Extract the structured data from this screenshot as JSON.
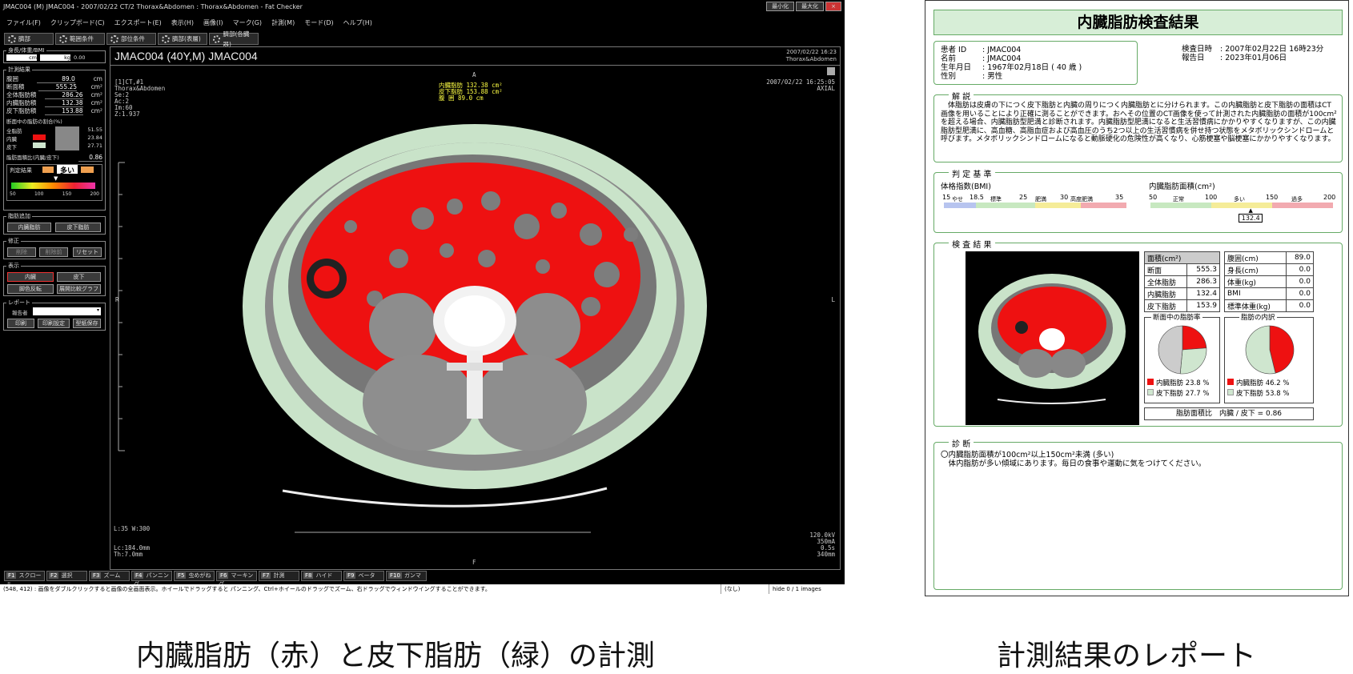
{
  "app": {
    "title": "JMAC004 (M) JMAC004 - 2007/02/22 CT/2 Thorax&Abdomen : Thorax&Abdomen - Fat Checker",
    "window_buttons": {
      "minimize": "最小化",
      "maximize": "最大化",
      "close": "×"
    },
    "menu": [
      "ファイル(F)",
      "クリップボード(C)",
      "エクスポート(E)",
      "表示(H)",
      "画像(I)",
      "マーク(G)",
      "計測(M)",
      "モード(D)",
      "ヘルプ(H)"
    ],
    "toolbar": [
      "臍部",
      "範囲条件",
      "部位条件",
      "臍部(表層)",
      "臍部(各臓器)"
    ],
    "panel": {
      "body_group": "身長/体重/BMI",
      "body_vals": [
        "cm",
        "kg",
        "0.00"
      ],
      "measure_group": "計測結果",
      "rows": [
        {
          "label": "腹囲",
          "value": "89.0",
          "unit": "cm"
        },
        {
          "label": "断面積",
          "value": "555.25",
          "unit": "cm²"
        },
        {
          "label": "全体脂肪積",
          "value": "286.26",
          "unit": "cm²"
        },
        {
          "label": "内臓脂肪積",
          "value": "132.38",
          "unit": "cm²"
        },
        {
          "label": "皮下脂肪積",
          "value": "153.88",
          "unit": "cm²"
        }
      ],
      "ratio_title": "断面中の脂肪の割合(%)",
      "ratio_rows": [
        {
          "label": "全脂肪",
          "value": "51.55"
        },
        {
          "label": "内臓",
          "value": "23.84"
        },
        {
          "label": "皮下",
          "value": "27.71"
        }
      ],
      "area_ratio_label": "脂肪面積比(内臓/皮下)",
      "area_ratio_value": "0.86",
      "judge_label": "判定結果",
      "judge_value": "多い",
      "scale_ticks": [
        "50",
        "100",
        "150",
        "200"
      ],
      "fat_add_group": "脂肪追加",
      "fat_add_buttons": [
        "内臓脂肪",
        "皮下脂肪"
      ],
      "fix_group": "修正",
      "fix_buttons": [
        "削除",
        "削除前",
        "リセット"
      ],
      "display_group": "表示",
      "display_buttons": [
        "内臓",
        "皮下",
        "脚色反転",
        "展開比較グラフ"
      ],
      "report_group": "レポート",
      "report_label": "報告者",
      "report_buttons": [
        "印刷",
        "印刷設定",
        "型紙保存"
      ]
    },
    "viewer": {
      "title": "JMAC004 (40Y,M) JMAC004",
      "date_top": "2007/02/22 16:23",
      "region_top": "Thorax&Abdomen",
      "info_left": [
        "[1]CT,#1",
        "Thorax&Abdomen",
        "Se:2",
        "Ac:2",
        "Im:60",
        "Z:1.937"
      ],
      "fat_overlay": [
        {
          "label": "内臓脂肪",
          "value": "132.38",
          "unit": "cm²"
        },
        {
          "label": "皮下脂肪",
          "value": "153.88",
          "unit": "cm²"
        },
        {
          "label": "腹 囲",
          "value": "89.0",
          "unit": "cm"
        }
      ],
      "info_right": [
        "2007/02/22 16:25:05",
        "AXIAL"
      ],
      "window": "L:35 W:300",
      "lc": "Lc:184.0mm",
      "th": "Th:7.0mm",
      "tech": [
        "120.0kV",
        "350mA",
        "0.5s",
        "340mm"
      ],
      "marker_A": "A",
      "marker_R": "R",
      "marker_L": "L",
      "marker_P": "P",
      "marker_F": "F"
    },
    "fkeys": [
      {
        "key": "F1",
        "label": "スクロール"
      },
      {
        "key": "F2",
        "label": "選択"
      },
      {
        "key": "F3",
        "label": "ズーム"
      },
      {
        "key": "F4",
        "label": "パンニング"
      },
      {
        "key": "F5",
        "label": "虫めがね"
      },
      {
        "key": "F6",
        "label": "マーキング"
      },
      {
        "key": "F7",
        "label": "計測"
      },
      {
        "key": "F8",
        "label": "ハイド"
      },
      {
        "key": "F9",
        "label": "ベータ"
      },
      {
        "key": "F10",
        "label": "ガンマ"
      }
    ],
    "status": "(548, 412) : 画像をダブルクリックすると画像の全画面表示。ホイールでドラッグすると パンニング、Ctrl+ホイールのドラッグでズーム、右ドラッグでウィンドウイングすることができます。",
    "status_right": [
      "(なし)",
      "hide 0 / 1 images"
    ]
  },
  "report": {
    "title": "内臓脂肪検査結果",
    "patient": [
      {
        "label": "患者 ID",
        "value": "JMAC004"
      },
      {
        "label": "名前",
        "value": "JMAC004"
      },
      {
        "label": "生年月日",
        "value": "1967年02月18日 ( 40 歳 )"
      },
      {
        "label": "性別",
        "value": "男性"
      }
    ],
    "dates": [
      {
        "label": "検査日時",
        "value": "2007年02月22日 16時23分"
      },
      {
        "label": "報告日",
        "value": "2023年01月06日"
      }
    ],
    "explain_title": "解 説",
    "explain_text": "　体脂肪は皮膚の下につく皮下脂肪と内臓の周りにつく内臓脂肪とに分けられます。この内臓脂肪と皮下脂肪の面積はCT画像を用いることにより正確に測ることができます。おへその位置のCT画像を使って計測された内臓脂肪の面積が100cm²を超える場合、内臓脂肪型肥満と診断されます。内臓脂肪型肥満になると生活習慣病にかかりやすくなりますが、この内臓脂肪型肥満に、高血糖、高脂血症および高血圧のうち2つ以上の生活習慣病を併せ持つ状態をメタボリックシンドロームと呼びます。メタボリックシンドロームになると動脈硬化の危険性が高くなり、心筋梗塞や脳梗塞にかかりやすくなります。",
    "criteria_title": "判 定 基 準",
    "bmi_title": "体格指数(BMI)",
    "bmi_ticks": [
      "15",
      "18.5",
      "25",
      "30",
      "35"
    ],
    "bmi_labels": [
      "やせ",
      "標準",
      "肥満",
      "高度肥満"
    ],
    "vfa_title": "内臓脂肪面積(cm²)",
    "vfa_ticks": [
      "50",
      "100",
      "150",
      "200"
    ],
    "vfa_labels": [
      "正常",
      "多い",
      "過多"
    ],
    "vfa_marker": "132.4",
    "vfa_marker_value": 132.4,
    "result_title": "検 査 結 果",
    "area_header": "面積(cm²)",
    "area_rows": [
      {
        "label": "断面",
        "value": "555.3"
      },
      {
        "label": "全体脂肪",
        "value": "286.3"
      },
      {
        "label": "内臓脂肪",
        "value": "132.4"
      },
      {
        "label": "皮下脂肪",
        "value": "153.9"
      }
    ],
    "body_rows": [
      {
        "label": "腹囲(cm)",
        "value": "89.0"
      },
      {
        "label": "身長(cm)",
        "value": "0.0"
      },
      {
        "label": "体重(kg)",
        "value": "0.0"
      },
      {
        "label": "BMI",
        "value": "0.0"
      },
      {
        "label": "標準体重(kg)",
        "value": "0.0"
      }
    ],
    "pie1_title": "断面中の脂肪率",
    "pie2_title": "脂肪の内訳",
    "pie1_legend": [
      {
        "label": "内臓脂肪",
        "value": "23.8 %"
      },
      {
        "label": "皮下脂肪",
        "value": "27.7 %"
      }
    ],
    "pie2_legend": [
      {
        "label": "内臓脂肪",
        "value": "46.2 %"
      },
      {
        "label": "皮下脂肪",
        "value": "53.8 %"
      }
    ],
    "ratio_text": "脂肪面積比　内臓 / 皮下 = 0.86",
    "diag_title": "診 断",
    "diag_line1": "〇内臓脂肪面積が100cm²以上150cm²未満 (多い)",
    "diag_line2": "　体内脂肪が多い傾域にあります。毎日の食事や運動に気をつけてください。"
  },
  "chart_data": [
    {
      "type": "pie",
      "title": "断面中の脂肪率",
      "labels": [
        "内臓脂肪",
        "皮下脂肪",
        "その他"
      ],
      "values": [
        23.8,
        27.7,
        48.5
      ],
      "colors": [
        "#e11",
        "#cfe6cf",
        "#ccc"
      ]
    },
    {
      "type": "pie",
      "title": "脂肪の内訳",
      "labels": [
        "内臓脂肪",
        "皮下脂肪"
      ],
      "values": [
        46.2,
        53.8
      ],
      "colors": [
        "#e11",
        "#cfe6cf"
      ]
    }
  ],
  "captions": {
    "left": "内臓脂肪（赤）と皮下脂肪（緑）の計測",
    "right": "計測結果のレポート"
  },
  "colors": {
    "visceral": "#ee1111",
    "subcutaneous": "#c9e3c9",
    "panel_bg": "#000000",
    "report_accent": "#66aa66"
  }
}
